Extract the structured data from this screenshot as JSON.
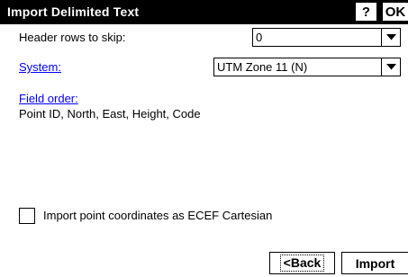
{
  "window": {
    "title": "Import Delimited Text",
    "help_label": "?",
    "ok_label": "OK"
  },
  "form": {
    "header_rows_label": "Header rows to skip:",
    "header_rows_value": "0",
    "system_label": "System:",
    "system_value": "UTM Zone 11 (N)",
    "field_order_label": "Field order:",
    "field_order_value": "Point ID, North, East, Height, Code",
    "ecef_label": "Import point coordinates as ECEF Cartesian",
    "ecef_checked": false
  },
  "footer": {
    "back_label": "<Back",
    "import_label": "Import"
  },
  "icons": {
    "dropdown_arrow": "chevron-down-icon",
    "checkbox": "checkbox-icon"
  },
  "colors": {
    "titlebar_bg": "#000000",
    "link": "#0000ff",
    "background": "#ffffff"
  }
}
